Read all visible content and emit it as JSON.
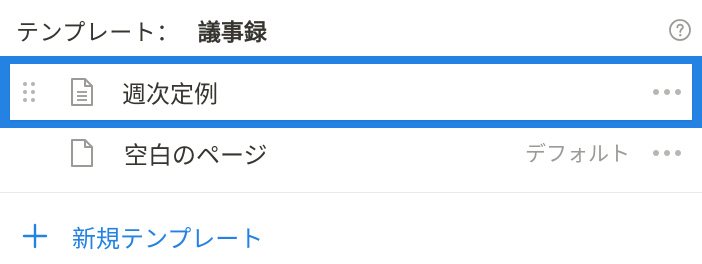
{
  "header": {
    "label": "テンプレート：",
    "name": "議事録",
    "help_icon": "question-circle-icon"
  },
  "templates": [
    {
      "title": "週次定例",
      "badge": "",
      "selected": true,
      "icon": "document-icon"
    },
    {
      "title": "空白のページ",
      "badge": "デフォルト",
      "selected": false,
      "icon": "blank-page-icon"
    }
  ],
  "footer": {
    "new_template_label": "新規テンプレート",
    "icon": "plus-icon"
  },
  "colors": {
    "accent": "#2382e2",
    "text": "#37352f",
    "muted": "#9b9a97",
    "divider": "#e9e9e7"
  }
}
